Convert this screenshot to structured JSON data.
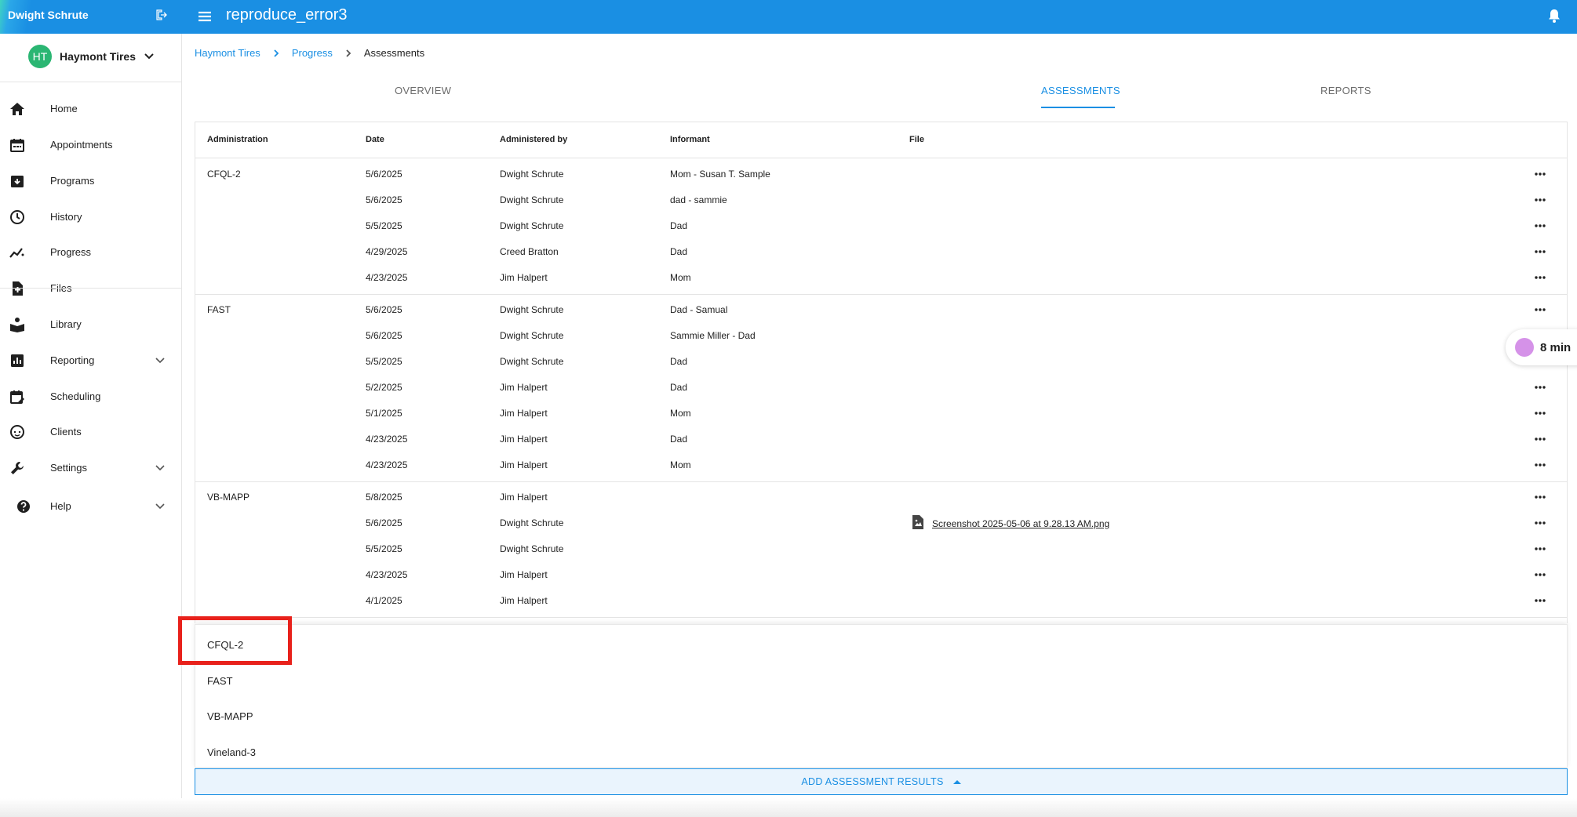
{
  "topbar": {
    "user_name": "Dwight Schrute",
    "app_title": "reproduce_error3",
    "icons": {
      "logout": "logout-icon",
      "menu": "hamburger-menu-icon",
      "bell": "notification-bell-icon"
    }
  },
  "org": {
    "initials": "HT",
    "name": "Haymont Tires"
  },
  "sidebar": {
    "items": [
      {
        "label": "Home",
        "icon": "home-icon"
      },
      {
        "label": "Appointments",
        "icon": "calendar-icon"
      },
      {
        "label": "Programs",
        "icon": "archive-box-icon"
      },
      {
        "label": "History",
        "icon": "clock-icon"
      },
      {
        "label": "Progress",
        "icon": "trend-line-icon"
      },
      {
        "label": "Files",
        "icon": "file-add-icon"
      },
      {
        "label": "Library",
        "icon": "book-reader-icon"
      },
      {
        "label": "Reporting",
        "icon": "bar-chart-icon"
      },
      {
        "label": "Scheduling",
        "icon": "calendar-edit-icon"
      },
      {
        "label": "Clients",
        "icon": "child-face-icon"
      },
      {
        "label": "Settings",
        "icon": "wrench-icon"
      },
      {
        "label": "Help",
        "icon": "help-circle-icon"
      }
    ]
  },
  "breadcrumb": {
    "items": [
      "Haymont Tires",
      "Progress",
      "Assessments"
    ]
  },
  "tabs": [
    "OVERVIEW",
    "ASSESSMENTS",
    "REPORTS"
  ],
  "table": {
    "columns": [
      "Administration",
      "Date",
      "Administered by",
      "Informant",
      "File"
    ],
    "groups": [
      {
        "name": "CFQL-2",
        "rows": [
          {
            "date": "5/6/2025",
            "by": "Dwight Schrute",
            "informant": "Mom - Susan T. Sample",
            "file": ""
          },
          {
            "date": "5/6/2025",
            "by": "Dwight Schrute",
            "informant": "dad - sammie",
            "file": ""
          },
          {
            "date": "5/5/2025",
            "by": "Dwight Schrute",
            "informant": "Dad",
            "file": ""
          },
          {
            "date": "4/29/2025",
            "by": "Creed Bratton",
            "informant": "Dad",
            "file": ""
          },
          {
            "date": "4/23/2025",
            "by": "Jim Halpert",
            "informant": "Mom",
            "file": ""
          }
        ]
      },
      {
        "name": "FAST",
        "rows": [
          {
            "date": "5/6/2025",
            "by": "Dwight Schrute",
            "informant": "Dad - Samual",
            "file": ""
          },
          {
            "date": "5/6/2025",
            "by": "Dwight Schrute",
            "informant": "Sammie Miller - Dad",
            "file": ""
          },
          {
            "date": "5/5/2025",
            "by": "Dwight Schrute",
            "informant": "Dad",
            "file": ""
          },
          {
            "date": "5/2/2025",
            "by": "Jim Halpert",
            "informant": "Dad",
            "file": ""
          },
          {
            "date": "5/1/2025",
            "by": "Jim Halpert",
            "informant": "Mom",
            "file": ""
          },
          {
            "date": "4/23/2025",
            "by": "Jim Halpert",
            "informant": "Dad",
            "file": ""
          },
          {
            "date": "4/23/2025",
            "by": "Jim Halpert",
            "informant": "Mom",
            "file": ""
          }
        ]
      },
      {
        "name": "VB-MAPP",
        "rows": [
          {
            "date": "5/8/2025",
            "by": "Jim Halpert",
            "informant": "",
            "file": ""
          },
          {
            "date": "5/6/2025",
            "by": "Dwight Schrute",
            "informant": "",
            "file": "Screenshot 2025-05-06 at 9.28.13 AM.png"
          },
          {
            "date": "5/5/2025",
            "by": "Dwight Schrute",
            "informant": "",
            "file": ""
          },
          {
            "date": "4/23/2025",
            "by": "Jim Halpert",
            "informant": "",
            "file": ""
          },
          {
            "date": "4/1/2025",
            "by": "Jim Halpert",
            "informant": "",
            "file": ""
          }
        ]
      }
    ]
  },
  "timer": {
    "label": "8 min"
  },
  "dropdown": {
    "options": [
      "CFQL-2",
      "FAST",
      "VB-MAPP",
      "Vineland-3"
    ]
  },
  "add_button": {
    "label": "ADD ASSESSMENT RESULTS"
  },
  "colors": {
    "primary": "#1a8fe3",
    "highlight": "#e8211b",
    "avatar": "#2bb673"
  }
}
